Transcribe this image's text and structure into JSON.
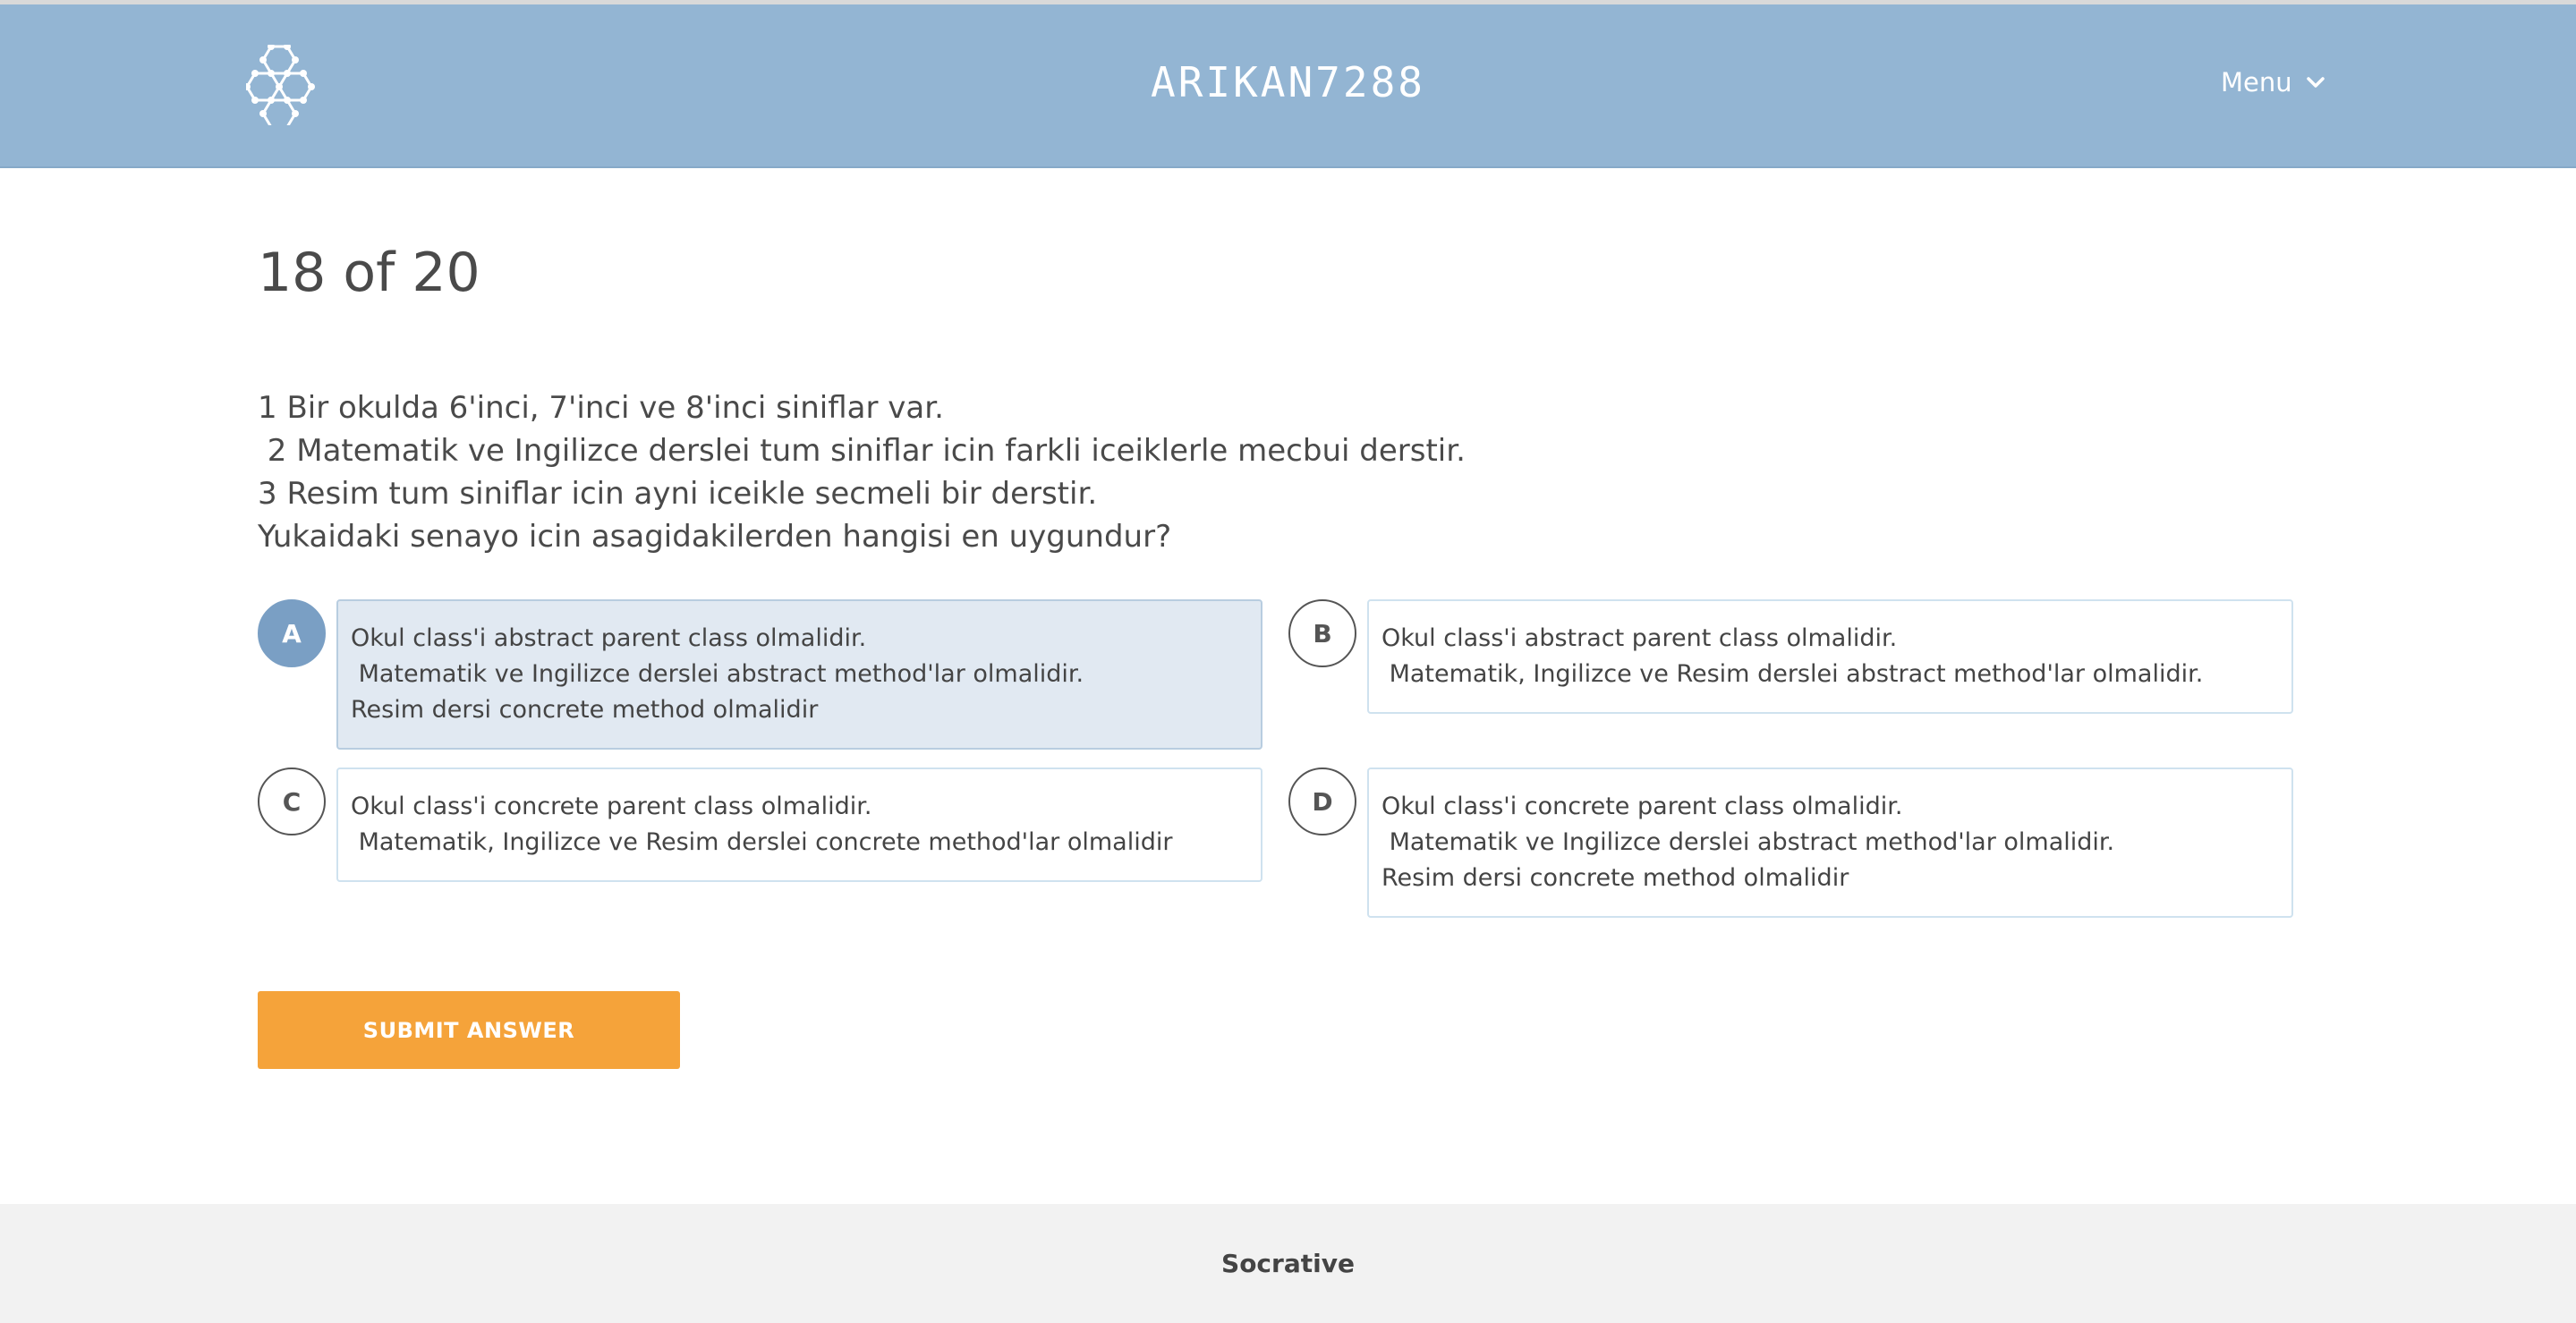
{
  "header": {
    "room_name": "ARIKAN7288",
    "menu_label": "Menu",
    "logo_icon": "hexagon-cluster-logo-icon",
    "menu_icon": "chevron-down-icon",
    "background_color": "#93b5d3"
  },
  "progress": {
    "text": "18 of 20",
    "current": 18,
    "total": 20
  },
  "question": {
    "lines": [
      "1 Bir okulda 6'inci, 7'inci ve 8'inci siniflar var.",
      " 2 Matematik ve Ingilizce derslei tum siniflar icin farkli iceiklerle mecbui derstir.",
      "3 Resim tum siniflar icin ayni iceikle secmeli bir derstir.",
      "Yukaidaki senayo icin asagidakilerden hangisi en uygundur?"
    ]
  },
  "options": [
    {
      "letter": "A",
      "selected": true,
      "lines": [
        "Okul class'i abstract parent class olmalidir.",
        " Matematik ve Ingilizce derslei abstract method'lar olmalidir.",
        "Resim dersi concrete method olmalidir"
      ]
    },
    {
      "letter": "B",
      "selected": false,
      "lines": [
        "Okul class'i abstract parent class olmalidir.",
        " Matematik, Ingilizce ve Resim derslei abstract method'lar olmalidir."
      ]
    },
    {
      "letter": "C",
      "selected": false,
      "lines": [
        "Okul class'i concrete parent class olmalidir.",
        " Matematik, Ingilizce ve Resim derslei concrete method'lar olmalidir"
      ]
    },
    {
      "letter": "D",
      "selected": false,
      "lines": [
        "Okul class'i concrete parent class olmalidir.",
        " Matematik ve Ingilizce derslei abstract method'lar olmalidir.",
        "Resim dersi concrete method olmalidir"
      ]
    }
  ],
  "submit": {
    "label": "SUBMIT ANSWER",
    "color": "#f5a33a"
  },
  "footer": {
    "brand": "Socrative"
  },
  "colors": {
    "selected_letter": "#7a9fc4",
    "selected_box": "#e1e9f2"
  }
}
